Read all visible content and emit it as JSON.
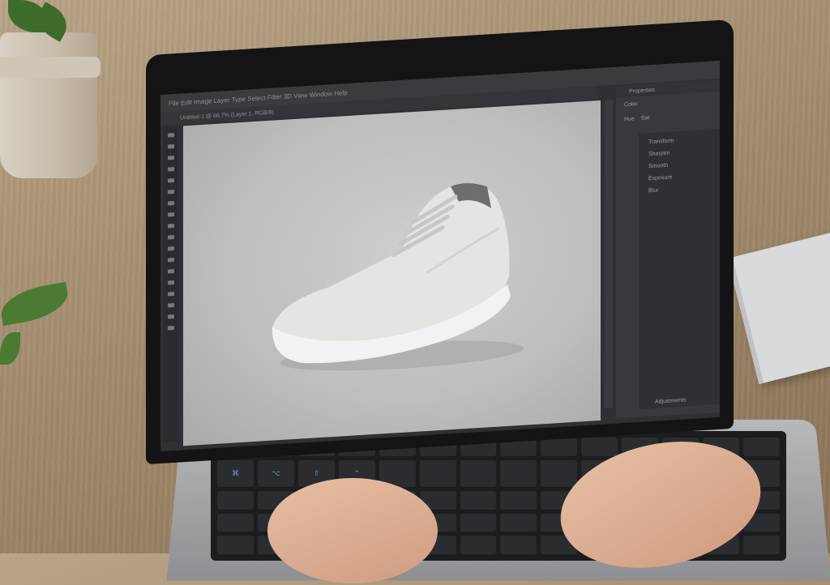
{
  "app": {
    "menubar_text": "File  Edit  Image  Layer  Type  Select  Filter  3D  View  Window  Help",
    "options_text": "Untitled-1 @ 66.7% (Layer 1, RGB/8)"
  },
  "panel": {
    "title": "Properties",
    "tab": "Color",
    "row_a": "Hue",
    "row_b": "Sat",
    "line_1": "Transform",
    "line_2": "Sharpen",
    "line_3": "Smooth",
    "line_4": "Exposure",
    "line_5": "Blur",
    "footer": "Adjustments"
  },
  "keyboard": {
    "highlighted_keys": [
      "⌘",
      "⌥",
      "⇧",
      "⌃"
    ]
  },
  "colors": {
    "ui_dark": "#2f3033",
    "canvas_bg": "#bdbdbd",
    "key_highlight": "#5aa6d6"
  }
}
